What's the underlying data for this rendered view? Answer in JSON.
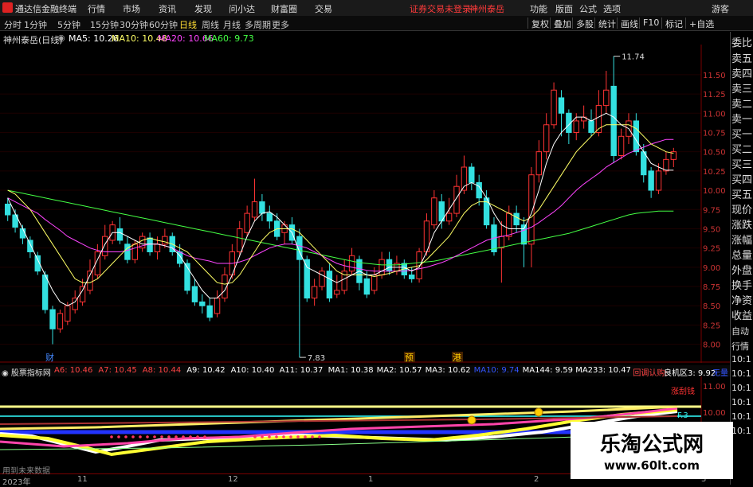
{
  "topbar": {
    "app_title": "通达信金融终端",
    "menus": [
      "行情",
      "市场",
      "资讯",
      "发现",
      "问小达",
      "财富圈",
      "交易"
    ],
    "warning": "证券交易未登录",
    "stock_link": "神州泰岳",
    "right_menus": [
      "功能",
      "版面",
      "公式",
      "选项"
    ],
    "guest": "游客"
  },
  "tabs": {
    "periods": [
      "分时",
      "1分钟",
      "5分钟",
      "15分钟",
      "30分钟",
      "60分钟",
      "日线",
      "周线",
      "月线",
      "多周期",
      "更多"
    ],
    "selected": "日线",
    "right_buttons": [
      "复权",
      "叠加",
      "多股",
      "统计",
      "画线",
      "F10",
      "标记",
      "+自选"
    ]
  },
  "main_legend": {
    "stock": "神州泰岳(日线)",
    "ma5": "MA5: 10.26",
    "ma10": "MA10: 10.48",
    "ma20": "MA20: 10.66",
    "ma60": "MA60: 9.73",
    "colors": {
      "ma5": "#ffffff",
      "ma10": "#ffff66",
      "ma20": "#ff44ff",
      "ma60": "#44ff44"
    }
  },
  "price_axis": {
    "ticks": [
      "11.50",
      "11.25",
      "11.00",
      "10.75",
      "10.50",
      "10.25",
      "10.00",
      "9.75",
      "9.50",
      "9.25",
      "9.00",
      "8.75",
      "8.50",
      "8.25",
      "8.00"
    ],
    "high_label": "11.74",
    "low_label": "7.83"
  },
  "markers": {
    "cai": "财",
    "yu": "预",
    "gang": "港"
  },
  "candles": [
    [
      9.82,
      9.68,
      9.9,
      9.6
    ],
    [
      9.68,
      9.52,
      9.75,
      9.45
    ],
    [
      9.5,
      9.38,
      9.55,
      9.3
    ],
    [
      9.35,
      9.2,
      9.4,
      9.12
    ],
    [
      9.15,
      8.95,
      9.2,
      8.9
    ],
    [
      8.9,
      8.45,
      8.95,
      8.4
    ],
    [
      8.45,
      8.2,
      8.5,
      8.0
    ],
    [
      8.2,
      8.4,
      8.45,
      8.15
    ],
    [
      8.3,
      8.5,
      8.55,
      8.25
    ],
    [
      8.45,
      8.6,
      8.7,
      8.4
    ],
    [
      8.55,
      8.75,
      8.85,
      8.5
    ],
    [
      8.7,
      8.95,
      9.1,
      8.65
    ],
    [
      8.9,
      9.2,
      9.3,
      8.85
    ],
    [
      9.15,
      9.4,
      9.55,
      9.1
    ],
    [
      9.35,
      9.55,
      9.6,
      9.3
    ],
    [
      9.5,
      9.35,
      9.65,
      9.3
    ],
    [
      9.3,
      9.1,
      9.4,
      9.05
    ],
    [
      9.1,
      9.3,
      9.35,
      9.05
    ],
    [
      9.25,
      9.4,
      9.45,
      9.2
    ],
    [
      9.38,
      9.2,
      9.45,
      9.15
    ],
    [
      9.2,
      9.3,
      9.4,
      9.1
    ],
    [
      9.3,
      9.4,
      9.5,
      9.25
    ],
    [
      9.4,
      9.2,
      9.45,
      9.15
    ],
    [
      9.2,
      9.05,
      9.3,
      9.0
    ],
    [
      9.05,
      8.7,
      9.1,
      8.65
    ],
    [
      8.75,
      8.55,
      8.85,
      8.5
    ],
    [
      8.55,
      8.5,
      8.65,
      8.4
    ],
    [
      8.5,
      8.35,
      8.6,
      8.3
    ],
    [
      8.4,
      8.6,
      8.7,
      8.35
    ],
    [
      8.6,
      8.9,
      9.0,
      8.55
    ],
    [
      8.9,
      9.2,
      9.3,
      8.85
    ],
    [
      9.2,
      9.5,
      9.6,
      9.15
    ],
    [
      9.45,
      9.7,
      9.8,
      9.4
    ],
    [
      9.65,
      9.85,
      10.15,
      9.6
    ],
    [
      9.85,
      9.7,
      9.95,
      9.6
    ],
    [
      9.7,
      9.6,
      9.8,
      9.5
    ],
    [
      9.6,
      9.4,
      9.7,
      9.35
    ],
    [
      9.45,
      9.55,
      9.6,
      9.3
    ],
    [
      9.55,
      9.35,
      9.65,
      9.3
    ],
    [
      9.4,
      9.1,
      9.5,
      7.83
    ],
    [
      9.1,
      8.6,
      9.15,
      8.55
    ],
    [
      8.6,
      8.75,
      8.85,
      8.5
    ],
    [
      8.75,
      8.95,
      9.0,
      8.7
    ],
    [
      8.95,
      8.6,
      9.05,
      8.55
    ],
    [
      8.65,
      8.7,
      8.9,
      8.6
    ],
    [
      8.7,
      8.95,
      9.1,
      8.65
    ],
    [
      8.95,
      9.15,
      9.25,
      8.9
    ],
    [
      9.1,
      8.8,
      9.15,
      8.7
    ],
    [
      8.85,
      8.65,
      8.95,
      8.6
    ],
    [
      8.7,
      8.9,
      9.0,
      8.65
    ],
    [
      8.9,
      9.1,
      9.2,
      8.85
    ],
    [
      9.1,
      8.95,
      9.2,
      8.9
    ],
    [
      8.95,
      9.05,
      9.15,
      8.9
    ],
    [
      9.05,
      8.9,
      9.1,
      8.85
    ],
    [
      8.9,
      8.85,
      9.0,
      8.8
    ],
    [
      8.85,
      9.2,
      9.25,
      8.8
    ],
    [
      9.2,
      9.6,
      9.7,
      9.15
    ],
    [
      9.55,
      9.9,
      10.0,
      9.5
    ],
    [
      9.85,
      9.6,
      9.95,
      9.5
    ],
    [
      9.6,
      9.7,
      9.9,
      9.55
    ],
    [
      9.7,
      10.05,
      10.2,
      9.65
    ],
    [
      10.0,
      10.3,
      10.45,
      9.95
    ],
    [
      10.3,
      10.1,
      10.35,
      10.0
    ],
    [
      10.1,
      9.9,
      10.2,
      9.8
    ],
    [
      9.9,
      9.55,
      10.0,
      9.5
    ],
    [
      9.55,
      9.2,
      9.65,
      9.15
    ],
    [
      9.25,
      9.4,
      9.6,
      8.8
    ],
    [
      9.4,
      9.7,
      9.8,
      9.35
    ],
    [
      9.7,
      9.55,
      9.8,
      9.45
    ],
    [
      9.55,
      9.3,
      9.65,
      9.0
    ],
    [
      9.3,
      10.2,
      10.3,
      9.0
    ],
    [
      10.2,
      10.5,
      10.65,
      10.1
    ],
    [
      10.5,
      10.85,
      11.0,
      10.4
    ],
    [
      10.85,
      11.3,
      11.4,
      10.8
    ],
    [
      11.2,
      11.0,
      11.3,
      10.7
    ],
    [
      11.0,
      10.75,
      11.05,
      10.6
    ],
    [
      10.75,
      10.9,
      11.0,
      10.65
    ],
    [
      10.9,
      10.95,
      11.1,
      10.8
    ],
    [
      10.9,
      10.75,
      11.05,
      10.7
    ],
    [
      10.75,
      11.1,
      11.3,
      10.7
    ],
    [
      11.1,
      11.3,
      11.55,
      11.0
    ],
    [
      11.35,
      10.45,
      11.74,
      10.35
    ],
    [
      10.45,
      10.7,
      10.8,
      10.4
    ],
    [
      10.7,
      10.9,
      11.0,
      10.6
    ],
    [
      10.9,
      10.5,
      11.0,
      10.45
    ],
    [
      10.5,
      10.2,
      10.6,
      10.1
    ],
    [
      10.25,
      10.0,
      10.3,
      9.9
    ],
    [
      10.0,
      10.25,
      10.35,
      9.95
    ],
    [
      10.25,
      10.4,
      10.5,
      10.2
    ],
    [
      10.4,
      10.5,
      10.55,
      10.3
    ]
  ],
  "ma_series": {
    "ma5": [
      9.9,
      9.7,
      9.5,
      9.3,
      9.1,
      8.9,
      8.7,
      8.55,
      8.5,
      8.55,
      8.7,
      8.9,
      9.1,
      9.3,
      9.45,
      9.45,
      9.4,
      9.35,
      9.3,
      9.3,
      9.3,
      9.28,
      9.25,
      9.15,
      9.0,
      8.85,
      8.7,
      8.6,
      8.6,
      8.7,
      8.9,
      9.15,
      9.4,
      9.6,
      9.7,
      9.72,
      9.65,
      9.55,
      9.45,
      9.2,
      9.0,
      8.95,
      8.9,
      8.85,
      8.8,
      8.85,
      8.9,
      8.95,
      8.9,
      8.9,
      8.95,
      9.0,
      9.0,
      9.0,
      8.95,
      9.0,
      9.2,
      9.45,
      9.6,
      9.75,
      9.9,
      10.05,
      10.1,
      10.05,
      9.9,
      9.7,
      9.55,
      9.5,
      9.5,
      9.5,
      9.7,
      10.0,
      10.35,
      10.6,
      10.75,
      10.85,
      10.95,
      10.95,
      10.9,
      10.95,
      11.0,
      10.95,
      10.85,
      10.8,
      10.65,
      10.5,
      10.35,
      10.3,
      10.26,
      10.26
    ],
    "ma10": [
      10.0,
      9.95,
      9.85,
      9.75,
      9.6,
      9.45,
      9.3,
      9.15,
      9.0,
      8.85,
      8.8,
      8.8,
      8.85,
      8.95,
      9.05,
      9.15,
      9.25,
      9.3,
      9.35,
      9.38,
      9.35,
      9.33,
      9.3,
      9.25,
      9.2,
      9.1,
      9.0,
      8.9,
      8.8,
      8.78,
      8.8,
      8.9,
      9.05,
      9.2,
      9.35,
      9.45,
      9.5,
      9.5,
      9.5,
      9.45,
      9.35,
      9.25,
      9.15,
      9.05,
      8.95,
      8.9,
      8.9,
      8.9,
      8.9,
      8.88,
      8.9,
      8.92,
      8.95,
      8.98,
      9.0,
      9.02,
      9.1,
      9.2,
      9.3,
      9.4,
      9.55,
      9.7,
      9.8,
      9.85,
      9.85,
      9.8,
      9.75,
      9.7,
      9.65,
      9.6,
      9.65,
      9.75,
      9.9,
      10.05,
      10.2,
      10.35,
      10.5,
      10.6,
      10.7,
      10.8,
      10.85,
      10.85,
      10.85,
      10.85,
      10.8,
      10.7,
      10.6,
      10.55,
      10.5,
      10.48
    ],
    "ma20": [
      9.9,
      9.85,
      9.8,
      9.75,
      9.7,
      9.62,
      9.55,
      9.48,
      9.4,
      9.35,
      9.3,
      9.25,
      9.22,
      9.2,
      9.2,
      9.2,
      9.22,
      9.25,
      9.28,
      9.3,
      9.3,
      9.28,
      9.25,
      9.2,
      9.15,
      9.12,
      9.1,
      9.08,
      9.05,
      9.05,
      9.05,
      9.07,
      9.1,
      9.15,
      9.2,
      9.25,
      9.28,
      9.3,
      9.3,
      9.28,
      9.25,
      9.2,
      9.15,
      9.1,
      9.05,
      9.02,
      9.0,
      8.98,
      8.96,
      8.95,
      8.95,
      8.95,
      8.95,
      8.95,
      8.96,
      8.98,
      9.0,
      9.03,
      9.06,
      9.1,
      9.15,
      9.2,
      9.25,
      9.3,
      9.35,
      9.38,
      9.4,
      9.42,
      9.45,
      9.48,
      9.52,
      9.58,
      9.65,
      9.72,
      9.8,
      9.9,
      10.0,
      10.08,
      10.15,
      10.22,
      10.3,
      10.36,
      10.42,
      10.48,
      10.52,
      10.56,
      10.6,
      10.63,
      10.66,
      10.66
    ],
    "ma60": [
      10.0,
      9.98,
      9.96,
      9.94,
      9.92,
      9.9,
      9.88,
      9.86,
      9.84,
      9.82,
      9.8,
      9.78,
      9.76,
      9.74,
      9.72,
      9.7,
      9.68,
      9.66,
      9.64,
      9.62,
      9.6,
      9.58,
      9.56,
      9.54,
      9.52,
      9.5,
      9.48,
      9.46,
      9.44,
      9.42,
      9.4,
      9.38,
      9.36,
      9.34,
      9.32,
      9.3,
      9.28,
      9.26,
      9.24,
      9.22,
      9.2,
      9.18,
      9.16,
      9.14,
      9.12,
      9.1,
      9.08,
      9.06,
      9.05,
      9.04,
      9.03,
      9.03,
      9.03,
      9.04,
      9.05,
      9.06,
      9.07,
      9.08,
      9.1,
      9.12,
      9.14,
      9.16,
      9.18,
      9.2,
      9.22,
      9.24,
      9.26,
      9.28,
      9.3,
      9.32,
      9.34,
      9.36,
      9.38,
      9.4,
      9.42,
      9.44,
      9.47,
      9.5,
      9.53,
      9.56,
      9.59,
      9.62,
      9.65,
      9.68,
      9.7,
      9.71,
      9.72,
      9.73,
      9.73,
      9.73
    ]
  },
  "sub_legend": {
    "name": "股票指标网",
    "items": [
      {
        "text": "A6: 10.46",
        "color": "#ff4444"
      },
      {
        "text": "A7: 10.45",
        "color": "#ff4444"
      },
      {
        "text": "A8: 10.44",
        "color": "#ff4444"
      },
      {
        "text": "A9: 10.42",
        "color": "#ffffff"
      },
      {
        "text": "A10: 10.40",
        "color": "#ffffff"
      },
      {
        "text": "A11: 10.37",
        "color": "#ffffff"
      },
      {
        "text": "MA1: 10.38",
        "color": "#ffffff"
      },
      {
        "text": "MA2: 10.57",
        "color": "#ffffff"
      },
      {
        "text": "MA3: 10.62",
        "color": "#ffffff"
      },
      {
        "text": "MA10: 9.74",
        "color": "#3355ff"
      },
      {
        "text": "MA144: 9.59",
        "color": "#ffffff"
      },
      {
        "text": "MA233: 10.47",
        "color": "#ffffff"
      },
      {
        "text": "回调认购: ",
        "color": "#ff4444"
      },
      {
        "text": "良机区3: 9.92",
        "color": "#ffffff"
      },
      {
        "text": "无量",
        "color": "#3355ff"
      }
    ]
  },
  "sub_axis": {
    "ticks": [
      "11.00",
      "10.00"
    ],
    "label_red": "涨刮钱",
    "label_cyan": "F.3"
  },
  "side_panel": {
    "items": [
      "委比",
      "卖五",
      "卖四",
      "卖三",
      "卖二",
      "卖一",
      "买一",
      "买二",
      "买三",
      "买四",
      "买五",
      "现价",
      "涨跌",
      "涨幅",
      "总量",
      "外盘",
      "换手",
      "净资",
      "收益",
      "自动",
      "行情",
      "10:1",
      "10:1",
      "10:1",
      "10:1",
      "10:1",
      "10:1"
    ]
  },
  "bottom_axis": {
    "labels": [
      "2023年",
      "11",
      "12",
      "1",
      "2",
      "3"
    ],
    "nodata": "用到未来数据"
  },
  "watermark": {
    "title": "乐淘公式网",
    "url": "www.60lt.com"
  }
}
